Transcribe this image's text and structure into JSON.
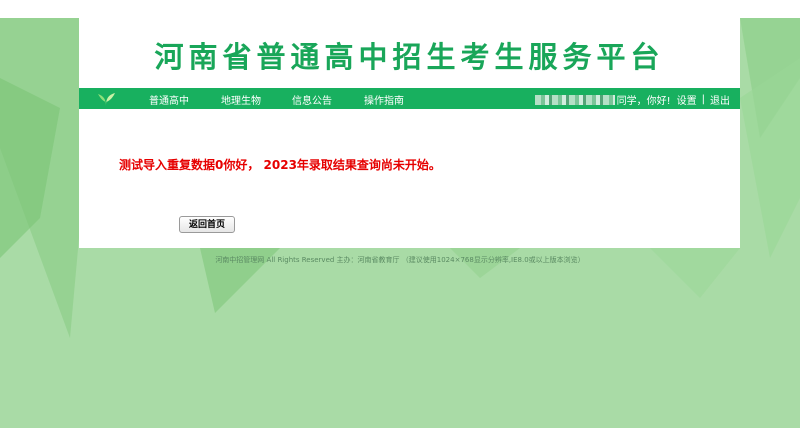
{
  "header": {
    "title": "河南省普通高中招生考生服务平台"
  },
  "nav": {
    "items": [
      "普通高中",
      "地理生物",
      "信息公告",
      "操作指南"
    ],
    "greeting": "同学，你好!",
    "settings": "设置",
    "separator": "|",
    "logout": "退出"
  },
  "main": {
    "message": "测试导入重复数据0你好， 2023年录取结果查询尚未开始。",
    "back_button": "返回首页"
  },
  "footer": {
    "text": "河南中招管理网 All Rights Reserved 主办：河南省教育厅 （建议使用1024×768显示分辨率,IE8.0或以上版本浏览）"
  },
  "colors": {
    "brand_green": "#18b05f",
    "title_green": "#19a659",
    "alert_red": "#e60000",
    "background": "#a9dba6"
  },
  "icons": {
    "nav_logo": "leaf-icon"
  }
}
